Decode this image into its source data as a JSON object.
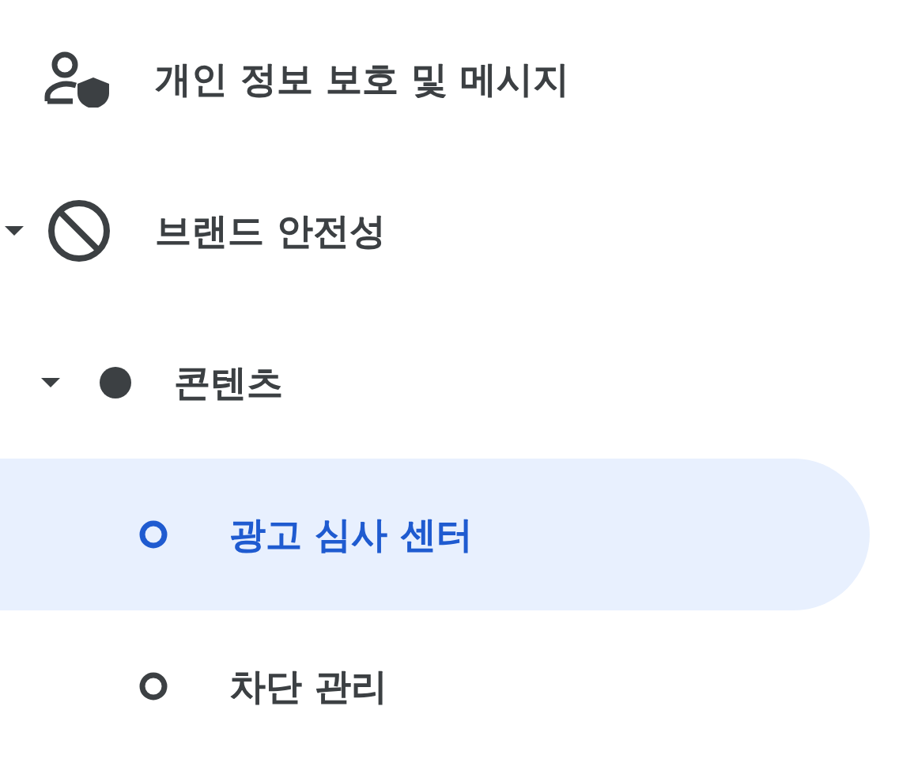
{
  "nav": [
    {
      "label": "개인 정보 보호 및 메시지",
      "kind": "person-shield",
      "selected": false
    },
    {
      "label": "브랜드 안전성",
      "kind": "ban",
      "selected": false,
      "expanded": true,
      "children": [
        {
          "label": "콘텐츠",
          "kind": "dot",
          "selected": false,
          "expanded": true,
          "children": [
            {
              "label": "광고 심사 센터",
              "kind": "ring",
              "selected": true
            },
            {
              "label": "차단 관리",
              "kind": "ring",
              "selected": false
            }
          ]
        }
      ]
    }
  ]
}
